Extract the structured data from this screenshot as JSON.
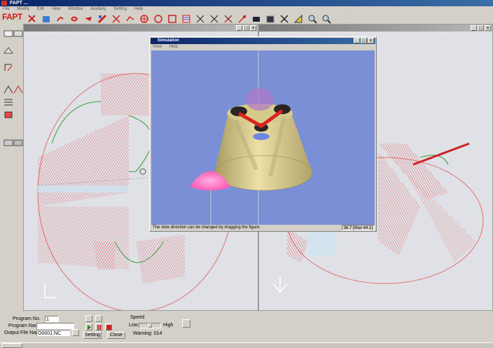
{
  "app": {
    "title": "FAPT ...",
    "logo": "FAPT"
  },
  "menu": [
    "File",
    "Modify",
    "Edit",
    "View",
    "Window",
    "Auxiliary",
    "Setting",
    "Help"
  ],
  "toolbar_icons": [
    "new-icon",
    "open-icon",
    "save-icon",
    "undo-icon",
    "redo-icon",
    "tool-icon",
    "cross-icon",
    "path-icon",
    "circle-icon",
    "target-icon",
    "square-icon",
    "grid-icon",
    "line-icon",
    "cut-icon",
    "move-icon",
    "measure-icon",
    "rect-icon",
    "fill-icon",
    "delete-icon",
    "ruler-icon",
    "zoom-in-icon",
    "zoom-out-icon"
  ],
  "left_toolbar_icons": [
    "shape-icon",
    "part-icon",
    "face-icon",
    "hole-icon",
    "pocket-icon",
    "slot-icon",
    "thread-icon",
    "edit-icon",
    "check-icon",
    "tool-path-icon"
  ],
  "view_left": {
    "title": ""
  },
  "view_right": {
    "title": ""
  },
  "simulation_window": {
    "title": "Simulation",
    "menu": [
      "View",
      "Help"
    ],
    "status_text": "The view direction can be changed by dragging the figure.",
    "status_value": "36.7 [Max 44.1]",
    "colors": {
      "background": "#7b8fd6",
      "part": "#d8cb8e",
      "tool": "#ff7fc8"
    }
  },
  "bottom_panel": {
    "program_no_label": "Program No.",
    "program_no_value": "1",
    "program_name_label": "Program Name",
    "program_name_value": "",
    "output_file_label": "Output File Name",
    "output_file_value": "O0001.NC",
    "setting_label": "Setting",
    "close_label": "Close",
    "speed_label": "Speed",
    "low_label": "Low",
    "high_label": "High",
    "warning_text": "Warning: 014"
  },
  "colors": {
    "toolpath": "#e53030",
    "contour": "#3c9a3c",
    "viewport": "#dfe1e6",
    "accent": "#cfe3f0"
  }
}
